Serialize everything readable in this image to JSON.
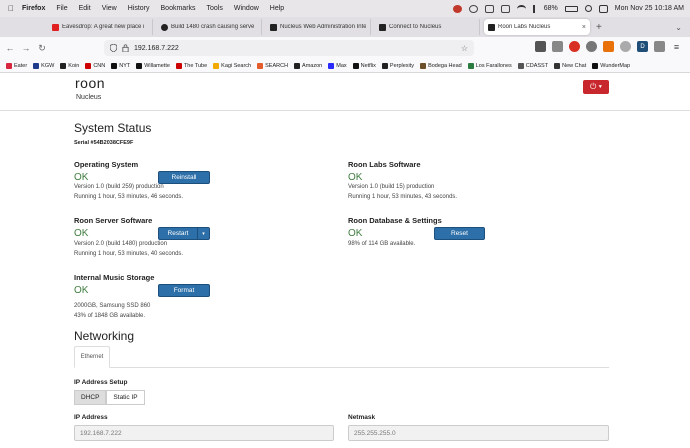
{
  "menubar": {
    "app": "Firefox",
    "items": [
      "File",
      "Edit",
      "View",
      "History",
      "Bookmarks",
      "Tools",
      "Window",
      "Help"
    ],
    "battery": "68%",
    "clock": "Mon Nov 25  10:18 AM"
  },
  "tabs": [
    {
      "label": "Eavesdrop: A great new place i",
      "color": "#e02020"
    },
    {
      "label": "Build 1480 crash causing serve",
      "color": "#222222"
    },
    {
      "label": "Nucleus Web Administration Inte",
      "color": "#222222"
    },
    {
      "label": "Connect to Nucleus",
      "color": "#222222"
    },
    {
      "label": "Roon Labs Nucleus",
      "color": "#222222"
    }
  ],
  "address": {
    "url": "192.168.7.222"
  },
  "bookmarks": [
    {
      "label": "Eater",
      "color": "#d7263d"
    },
    {
      "label": "KGW",
      "color": "#1e3a8a"
    },
    {
      "label": "Koin",
      "color": "#222222"
    },
    {
      "label": "CNN",
      "color": "#cc0000"
    },
    {
      "label": "NYT",
      "color": "#111111"
    },
    {
      "label": "Willamette",
      "color": "#111111"
    },
    {
      "label": "The Tube",
      "color": "#cc0000"
    },
    {
      "label": "Kagi Search",
      "color": "#f2a900"
    },
    {
      "label": "SEARCH",
      "color": "#e45c2b"
    },
    {
      "label": "Amazon",
      "color": "#222222"
    },
    {
      "label": "Max",
      "color": "#2a2aff"
    },
    {
      "label": "Netflix",
      "color": "#111111"
    },
    {
      "label": "Perplexity",
      "color": "#222222"
    },
    {
      "label": "Bodega Head",
      "color": "#6b4f2a"
    },
    {
      "label": "Los Farallones",
      "color": "#2b7a3e"
    },
    {
      "label": "CDASST",
      "color": "#555555"
    },
    {
      "label": "New Chat",
      "color": "#333333"
    },
    {
      "label": "WunderMap",
      "color": "#111111"
    }
  ],
  "roon": {
    "logo": "roon",
    "subtitle": "Nucleus",
    "power_icon": "power-icon"
  },
  "system_status": {
    "title": "System Status",
    "serial": "Serial #54B2038CFE9F",
    "os": {
      "title": "Operating System",
      "status": "OK",
      "button": "Reinstall",
      "line1": "Version 1.0 (build 259) production",
      "line2": "Running 1 hour, 53 minutes, 46 seconds."
    },
    "roon_labs": {
      "title": "Roon Labs Software",
      "status": "OK",
      "line1": "Version 1.0 (build 15) production",
      "line2": "Running 1 hour, 53 minutes, 43 seconds."
    },
    "server": {
      "title": "Roon Server Software",
      "status": "OK",
      "button": "Restart",
      "line1": "Version 2.0 (build 1480) production",
      "line2": "Running 1 hour, 53 minutes, 40 seconds."
    },
    "database": {
      "title": "Roon Database & Settings",
      "status": "OK",
      "button": "Reset",
      "line1": "98% of 114 GB available."
    },
    "storage": {
      "title": "Internal Music Storage",
      "status": "OK",
      "button": "Format",
      "line1": "2000GB, Samsung SSD 860",
      "line2": "43% of 1848 GB available."
    }
  },
  "networking": {
    "title": "Networking",
    "tab": "Ethernet",
    "ip_setup_label": "IP Address Setup",
    "dhcp": "DHCP",
    "static": "Static IP",
    "ip_label": "IP Address",
    "ip_value": "192.168.7.222",
    "netmask_label": "Netmask",
    "netmask_value": "255.255.255.0"
  }
}
